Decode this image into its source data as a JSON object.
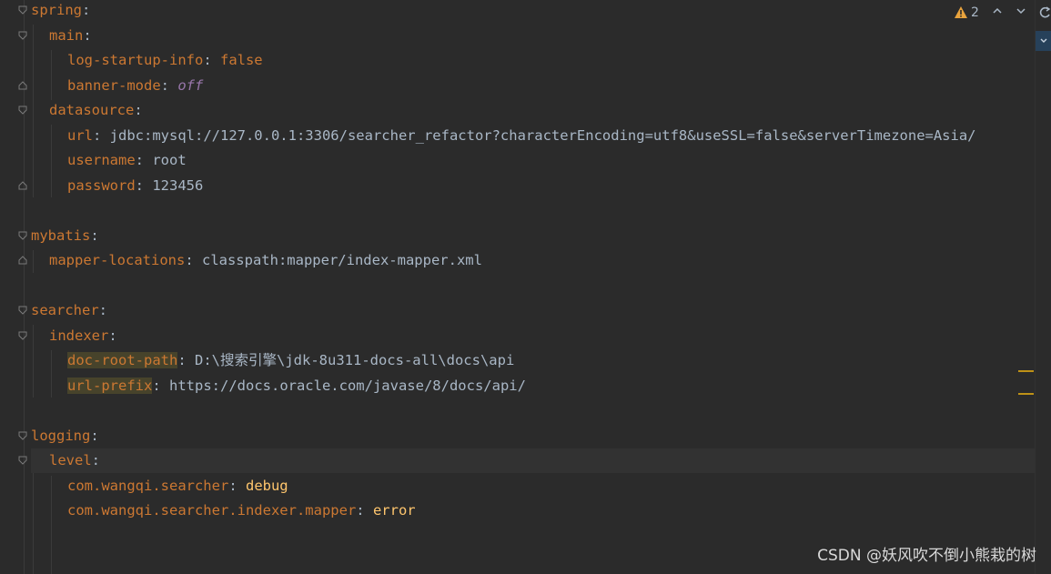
{
  "toolbar": {
    "warning_count": "2"
  },
  "lines": [
    {
      "key": "spring",
      "sep": ":",
      "value": ""
    },
    {
      "key": "main",
      "sep": ":",
      "value": ""
    },
    {
      "key": "log-startup-info",
      "sep": ": ",
      "value": "false"
    },
    {
      "key": "banner-mode",
      "sep": ": ",
      "value": "off"
    },
    {
      "key": "datasource",
      "sep": ":",
      "value": ""
    },
    {
      "key": "url",
      "sep": ": ",
      "value": "jdbc:mysql://127.0.0.1:3306/searcher_refactor?characterEncoding=utf8&useSSL=false&serverTimezone=Asia/"
    },
    {
      "key": "username",
      "sep": ": ",
      "value": "root"
    },
    {
      "key": "password",
      "sep": ": ",
      "value": "123456"
    },
    {
      "key": "mybatis",
      "sep": ":",
      "value": ""
    },
    {
      "key": "mapper-locations",
      "sep": ": ",
      "value": "classpath:mapper/index-mapper.xml"
    },
    {
      "key": "searcher",
      "sep": ":",
      "value": ""
    },
    {
      "key": "indexer",
      "sep": ":",
      "value": ""
    },
    {
      "key": "doc-root-path",
      "sep": ": ",
      "value": "D:\\搜索引擎\\jdk-8u311-docs-all\\docs\\api"
    },
    {
      "key": "url-prefix",
      "sep": ": ",
      "value": "https://docs.oracle.com/javase/8/docs/api/"
    },
    {
      "key": "logging",
      "sep": ":",
      "value": ""
    },
    {
      "key": "level",
      "sep": ":",
      "value": ""
    },
    {
      "key": "com.wangqi.searcher",
      "sep": ": ",
      "value": "debug"
    },
    {
      "key": "com.wangqi.searcher.indexer.mapper",
      "sep": ": ",
      "value": "error"
    }
  ],
  "watermark": "CSDN @妖风吹不倒小熊栽的树",
  "colors": {
    "background": "#2b2b2b",
    "key": "#cc7832",
    "text": "#a9b7c6",
    "italic_value": "#9876aa",
    "log_value": "#ffc66d",
    "highlight": "#47432b",
    "warning": "#e8a33d"
  }
}
